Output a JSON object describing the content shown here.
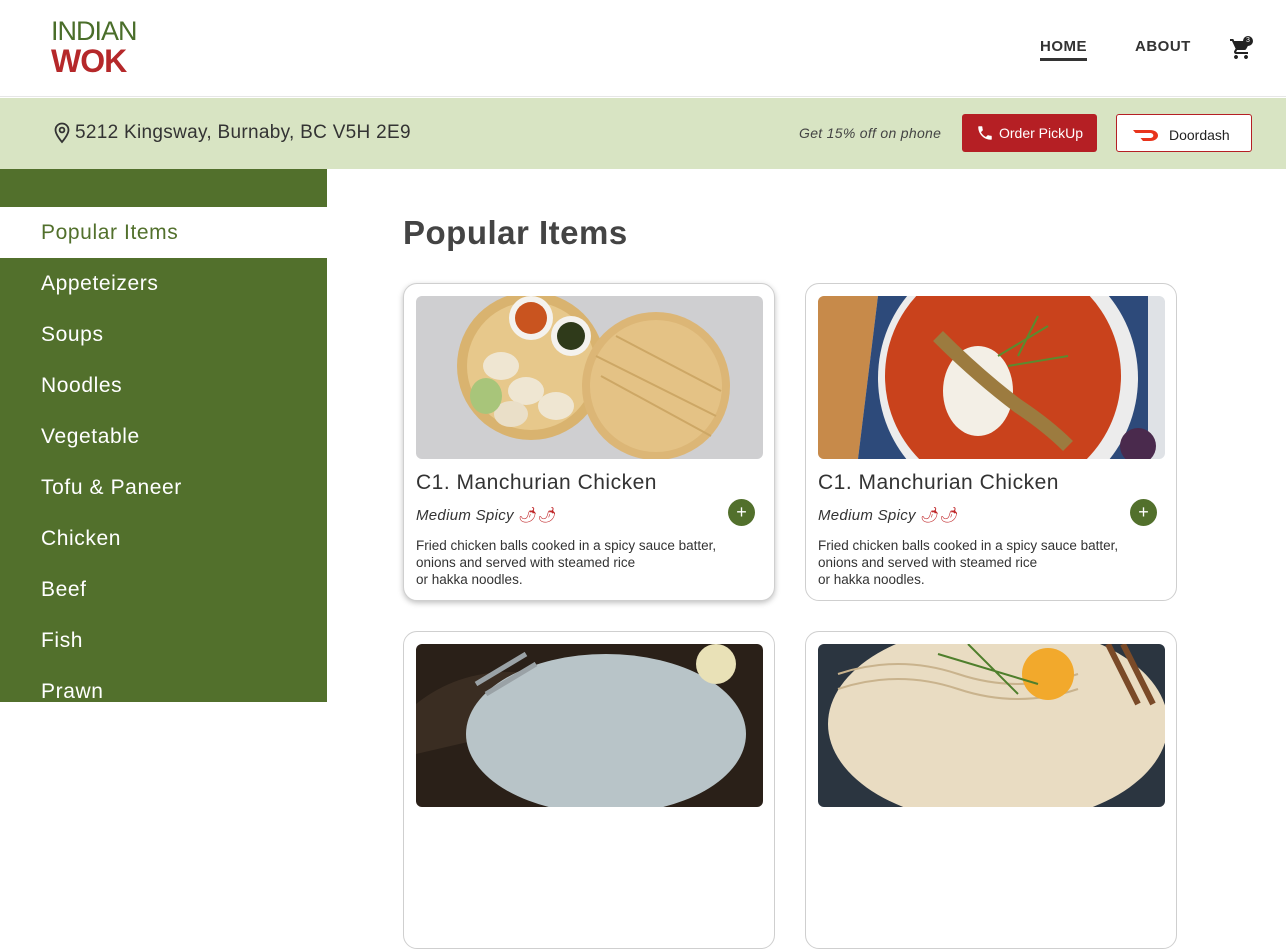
{
  "brand": {
    "logo_line1": "INDIAN",
    "logo_line2": "WOK"
  },
  "nav": {
    "home": "HOME",
    "about": "ABOUT",
    "cart_count": "3"
  },
  "info": {
    "address": "5212 Kingsway, Burnaby, BC V5H 2E9",
    "promo": "Get 15% off on phone",
    "pickup_label": "Order PickUp",
    "doordash_label": "Doordash"
  },
  "sidebar": {
    "items": [
      {
        "label": "Popular Items",
        "active": true
      },
      {
        "label": "Appeteizers"
      },
      {
        "label": "Soups"
      },
      {
        "label": "Noodles"
      },
      {
        "label": "Vegetable"
      },
      {
        "label": "Tofu & Paneer"
      },
      {
        "label": "Chicken"
      },
      {
        "label": "Beef"
      },
      {
        "label": "Fish"
      },
      {
        "label": "Prawn"
      }
    ]
  },
  "main": {
    "title": "Popular Items",
    "cards": [
      {
        "title": "C1. Manchurian Chicken",
        "spicy": "Medium Spicy",
        "chili": "🌶🌶",
        "add": "+",
        "desc_lines": [
          "Fried chicken balls cooked in a spicy sauce batter,",
          "onions and served with steamed rice",
          "or hakka noodles."
        ]
      },
      {
        "title": "C1. Manchurian Chicken",
        "spicy": "Medium Spicy",
        "chili": "🌶🌶",
        "add": "+",
        "desc_lines": [
          "Fried chicken balls cooked in a spicy sauce batter,",
          "onions and served with steamed rice",
          "or hakka noodles."
        ]
      }
    ]
  },
  "colors": {
    "brand_green": "#52702c",
    "brand_red": "#b51f24",
    "infobar_bg": "#d8e4c3"
  }
}
